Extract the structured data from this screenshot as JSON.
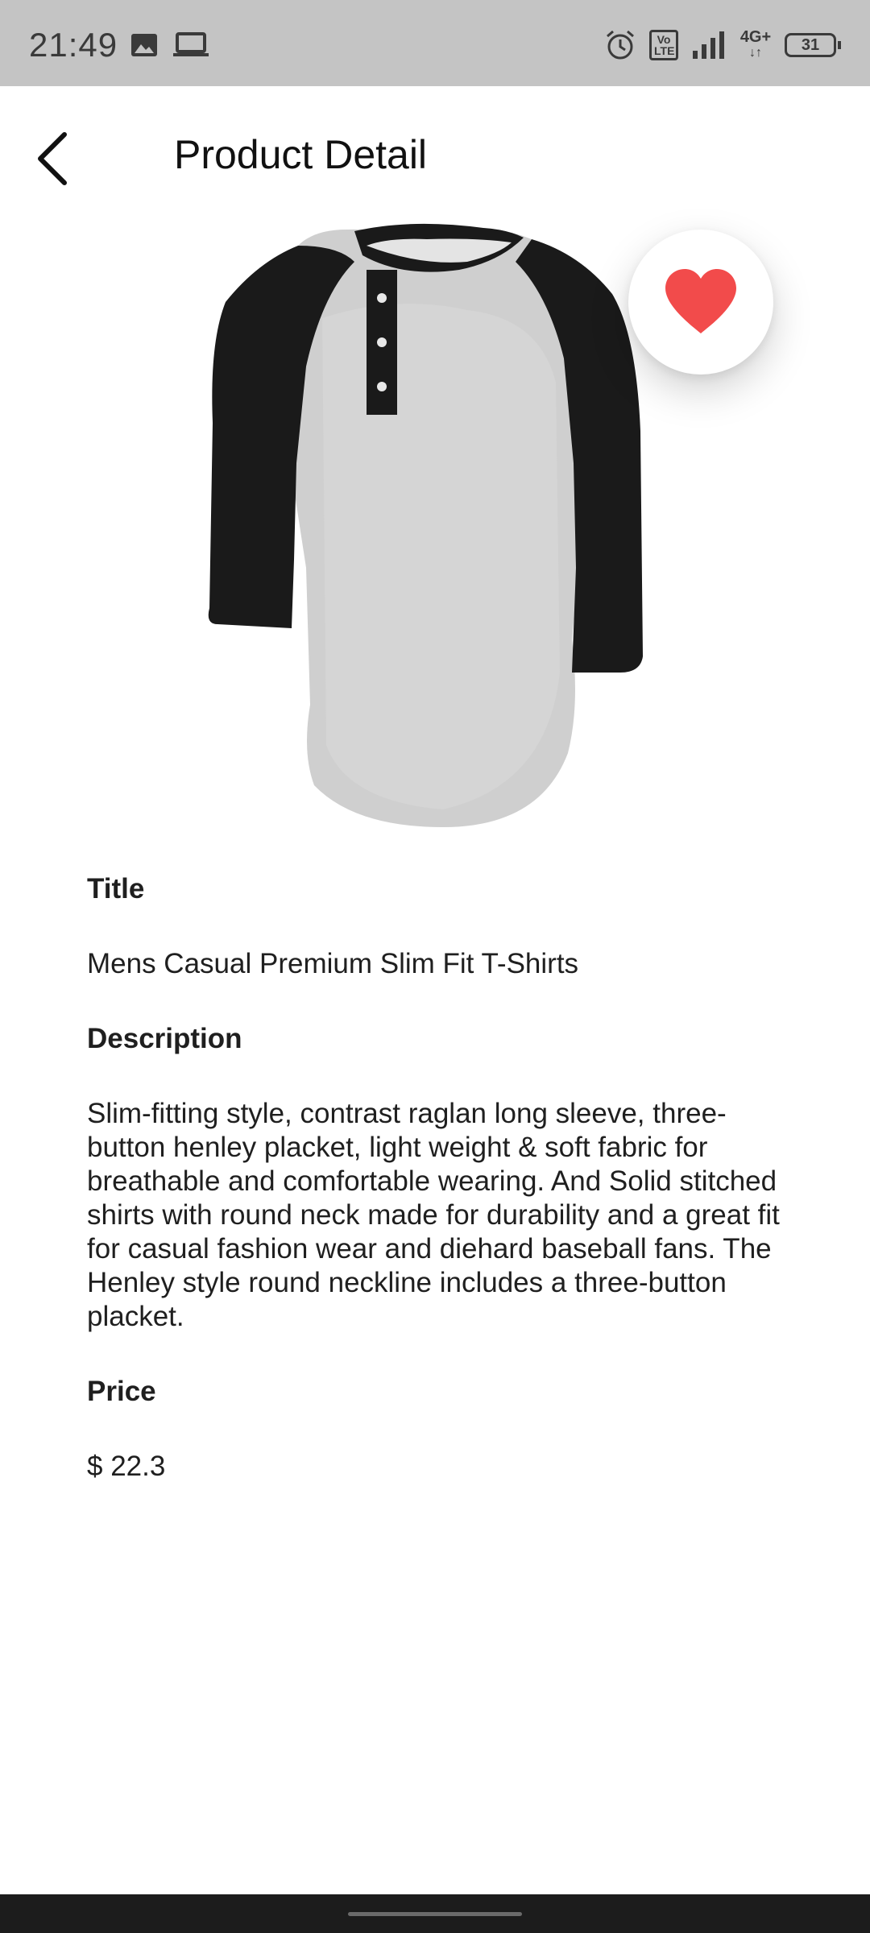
{
  "status_bar": {
    "time": "21:49",
    "icons": [
      "image-icon",
      "laptop-icon",
      "alarm-icon",
      "volte-icon",
      "signal-icon",
      "4g-icon",
      "battery-icon"
    ],
    "network_label": "4G+",
    "volte_label": "Vo LTE",
    "battery": "31"
  },
  "header": {
    "title": "Product Detail",
    "back_icon": "chevron-left-icon"
  },
  "product": {
    "favorite_icon": "heart-icon",
    "favorite_color": "#f24b4b",
    "title_label": "Title",
    "title": "Mens Casual Premium Slim Fit T-Shirts",
    "description_label": "Description",
    "description": "Slim-fitting style, contrast raglan long sleeve, three-button henley placket, light weight & soft fabric for breathable and comfortable wearing. And Solid stitched shirts with round neck made for durability and a great fit for casual fashion wear and diehard baseball fans. The Henley style round neckline includes a three-button placket.",
    "price_label": "Price",
    "price": "$ 22.3"
  }
}
